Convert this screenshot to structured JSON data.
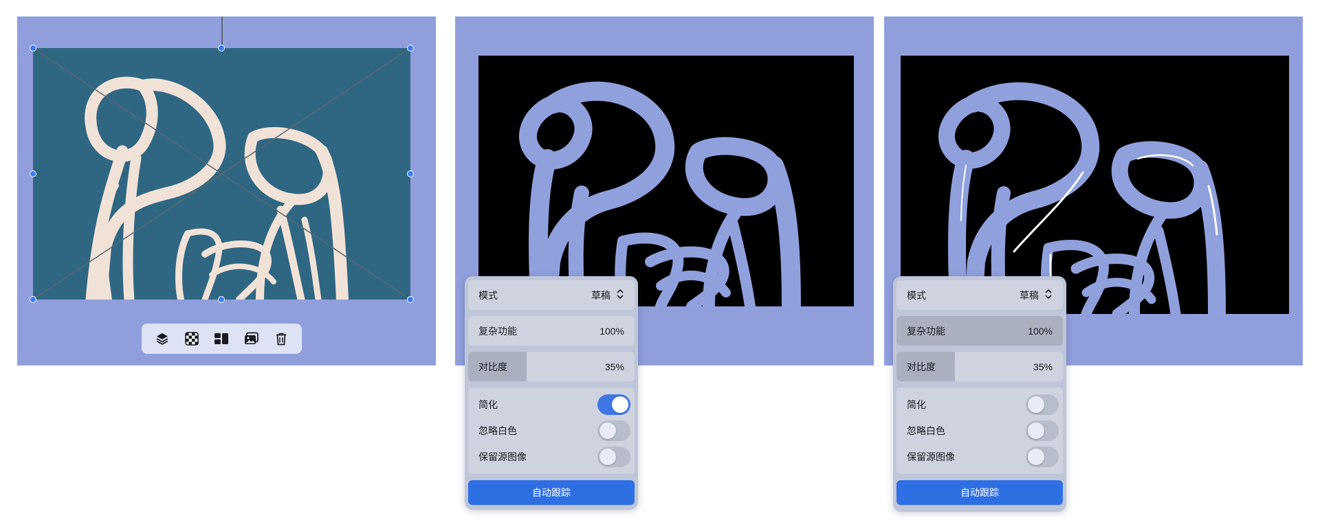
{
  "colors": {
    "canvas_background": "#909fdc",
    "photo_sky": "#2f6783",
    "sculpture": "#f1e2d8",
    "trace_fill": "#8fa0dd",
    "selection_handle": "#3b7df6",
    "primary_button": "#2f6fe4",
    "toggle_on": "#3f78e6"
  },
  "toolbar": {
    "tools": [
      {
        "icon": "layers-icon"
      },
      {
        "icon": "transparency-grid-icon"
      },
      {
        "icon": "arrange-icon"
      },
      {
        "icon": "replace-image-icon"
      },
      {
        "icon": "trash-icon"
      }
    ]
  },
  "trace_panels": [
    {
      "mode_label": "模式",
      "mode_value": "草稿",
      "complexity_label": "复杂功能",
      "complexity_value": "100%",
      "complexity_level": 0,
      "contrast_label": "对比度",
      "contrast_value": "35%",
      "contrast_level": 0.35,
      "simplify_label": "简化",
      "simplify_on": true,
      "ignore_white_label": "忽略白色",
      "ignore_white_on": false,
      "keep_source_label": "保留源图像",
      "keep_source_on": false,
      "auto_trace_label": "自动跟踪"
    },
    {
      "mode_label": "模式",
      "mode_value": "草稿",
      "complexity_label": "复杂功能",
      "complexity_value": "100%",
      "complexity_level": 1,
      "contrast_label": "对比度",
      "contrast_value": "35%",
      "contrast_level": 0.35,
      "simplify_label": "简化",
      "simplify_on": false,
      "ignore_white_label": "忽略白色",
      "ignore_white_on": false,
      "keep_source_label": "保留源图像",
      "keep_source_on": false,
      "auto_trace_label": "自动跟踪"
    }
  ]
}
